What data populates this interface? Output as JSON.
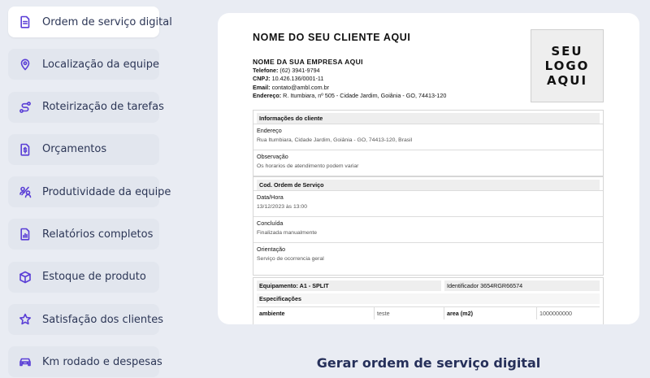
{
  "sidebar": {
    "items": [
      {
        "label": "Ordem de serviço digital",
        "icon": "document-icon",
        "active": true
      },
      {
        "label": "Localização da equipe",
        "icon": "location-pin-icon"
      },
      {
        "label": "Roteirização de tarefas",
        "icon": "route-icon"
      },
      {
        "label": "Orçamentos",
        "icon": "dollar-document-icon"
      },
      {
        "label": "Produtividade da equipe",
        "icon": "team-icon"
      },
      {
        "label": "Relatórios completos",
        "icon": "report-icon"
      },
      {
        "label": "Estoque de produto",
        "icon": "box-icon"
      },
      {
        "label": "Satisfação dos clientes",
        "icon": "star-icon"
      },
      {
        "label": "Km rodado e despesas",
        "icon": "car-icon"
      }
    ]
  },
  "doc": {
    "client_name": "NOME DO SEU CLIENTE AQUI",
    "logo": [
      "SEU",
      "LOGO",
      "AQUI"
    ],
    "company": {
      "name": "NOME DA SUA EMPRESA AQUI",
      "phone_label": "Telefone:",
      "phone": "(62) 3941-9794",
      "cnpj_label": "CNPJ:",
      "cnpj": "10.426.136/0001-11",
      "email_label": "Email:",
      "email": "contato@ambl.com.br",
      "address_label": "Endereço:",
      "address": "R. Itumbiara, nº 505 - Cidade Jardim, Goiânia - GO, 74413-120"
    },
    "client_info": {
      "header": "Informações do cliente",
      "address_label": "Endereço",
      "address_value": "Rua Itumbiara, Cidade Jardim, Goiânia - GO, 74413-120, Brasil",
      "note_label": "Observação",
      "note_value": "Os horarios de atendimento podem variar"
    },
    "order": {
      "header": "Cod. Ordem de Serviço",
      "date_label": "Data/Hora",
      "date_value": "13/12/2023 às 13:00",
      "done_label": "Concluída",
      "done_value": "Finalizada manualmente",
      "orientation_label": "Orientação",
      "orientation_value": "Serviço de ocorrencia geral"
    },
    "equipment": {
      "name": "Equipamento: A1 - SPLIT",
      "identifier": "Identificador 3654RGR66574",
      "spec_header": "Especificações",
      "spec": {
        "k1": "ambiente",
        "v1": "teste",
        "k2": "area (m2)",
        "v2": "1000000000"
      }
    }
  },
  "caption": "Gerar ordem de serviço digital",
  "colors": {
    "accent": "#5a3ed6",
    "caption": "#26305a",
    "background": "#e9ecf3"
  }
}
